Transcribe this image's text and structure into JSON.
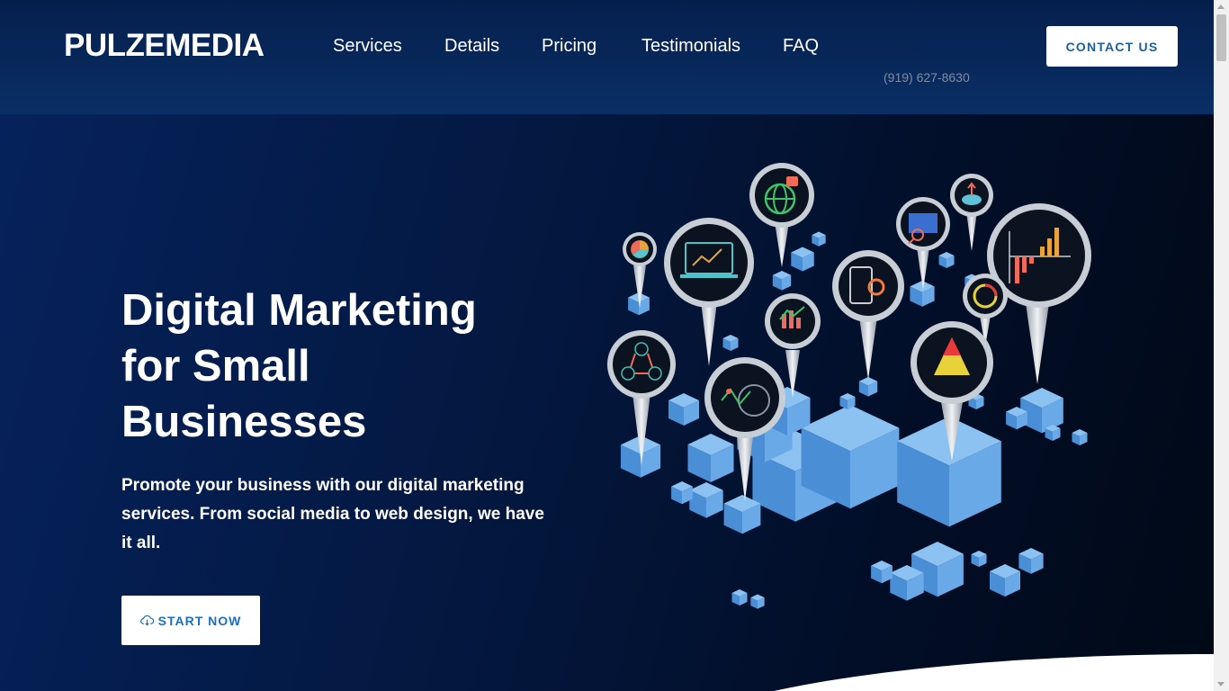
{
  "brand": {
    "name": "PULZEMEDIA"
  },
  "nav": {
    "items": [
      {
        "label": "Services"
      },
      {
        "label": "Details"
      },
      {
        "label": "Pricing"
      },
      {
        "label": "Testimonials"
      },
      {
        "label": "FAQ"
      }
    ],
    "phone": "(919) 627-8630",
    "contact_label": "CONTACT US"
  },
  "hero": {
    "title_strong": "Digital Marketing",
    "title_line2": "for Small",
    "title_line3": "Businesses",
    "description": "Promote your business with our digital marketing services. From social media to web design, we have it all.",
    "cta_label": "START NOW",
    "cta_icon": "cloud-download-icon"
  },
  "colors": {
    "header_bg": "#0a2f66",
    "hero_bg": "#041a45",
    "accent": "#1a6fc4",
    "cube": "#5b9ee0"
  },
  "illustration": {
    "icons": [
      "pie-chart-icon",
      "monitor-analytics-icon",
      "globe-alert-icon",
      "web-search-icon",
      "cloud-upload-icon",
      "bar-chart-icon",
      "cycle-abc-icon",
      "line-chart-icon",
      "binary-gear-icon",
      "pyramid-chart-icon",
      "percent-target-icon",
      "globe-trend-icon"
    ]
  }
}
